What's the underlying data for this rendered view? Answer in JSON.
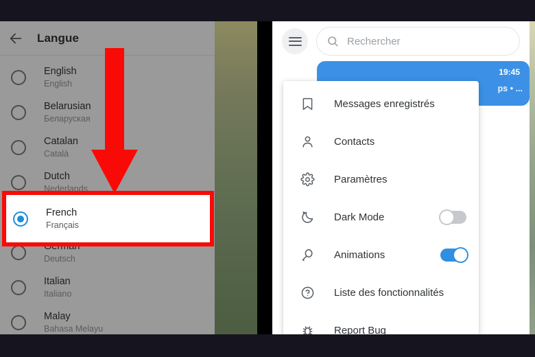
{
  "left_panel": {
    "back_icon": "back-arrow-icon",
    "title": "Langue",
    "languages": [
      {
        "name": "English",
        "native": "English",
        "selected": false
      },
      {
        "name": "Belarusian",
        "native": "Беларуская",
        "selected": false
      },
      {
        "name": "Catalan",
        "native": "Català",
        "selected": false
      },
      {
        "name": "Dutch",
        "native": "Nederlands",
        "selected": false
      },
      {
        "name": "French",
        "native": "Français",
        "selected": true
      },
      {
        "name": "German",
        "native": "Deutsch",
        "selected": false
      },
      {
        "name": "Italian",
        "native": "Italiano",
        "selected": false
      },
      {
        "name": "Malay",
        "native": "Bahasa Melayu",
        "selected": false
      }
    ]
  },
  "right_panel": {
    "menu_button_icon": "hamburger-menu-icon",
    "search": {
      "icon": "search-icon",
      "placeholder": "Rechercher",
      "value": ""
    },
    "chat_bubble": {
      "time": "19:45",
      "preview": "ps • ..."
    },
    "dropdown": {
      "items": [
        {
          "icon": "bookmark-icon",
          "label": "Messages enregistrés",
          "toggle": null
        },
        {
          "icon": "person-icon",
          "label": "Contacts",
          "toggle": null
        },
        {
          "icon": "gear-icon",
          "label": "Paramètres",
          "toggle": null
        },
        {
          "icon": "moon-icon",
          "label": "Dark Mode",
          "toggle": "off"
        },
        {
          "icon": "balloon-icon",
          "label": "Animations",
          "toggle": "on"
        },
        {
          "icon": "question-circle-icon",
          "label": "Liste des fonctionnalités",
          "toggle": null
        },
        {
          "icon": "bug-icon",
          "label": "Report Bug",
          "toggle": null
        }
      ]
    }
  },
  "annotations": {
    "arrow_color": "#fa0a07",
    "highlight_color": "#fa0a07",
    "highlight_target": "French"
  },
  "colors": {
    "frame": "#16141f",
    "left_panel_bg": "#9a9a9a",
    "accent_blue": "#2f8fe0",
    "radio_selected": "#1c8ddb",
    "bubble_blue": "#3c91e6"
  }
}
